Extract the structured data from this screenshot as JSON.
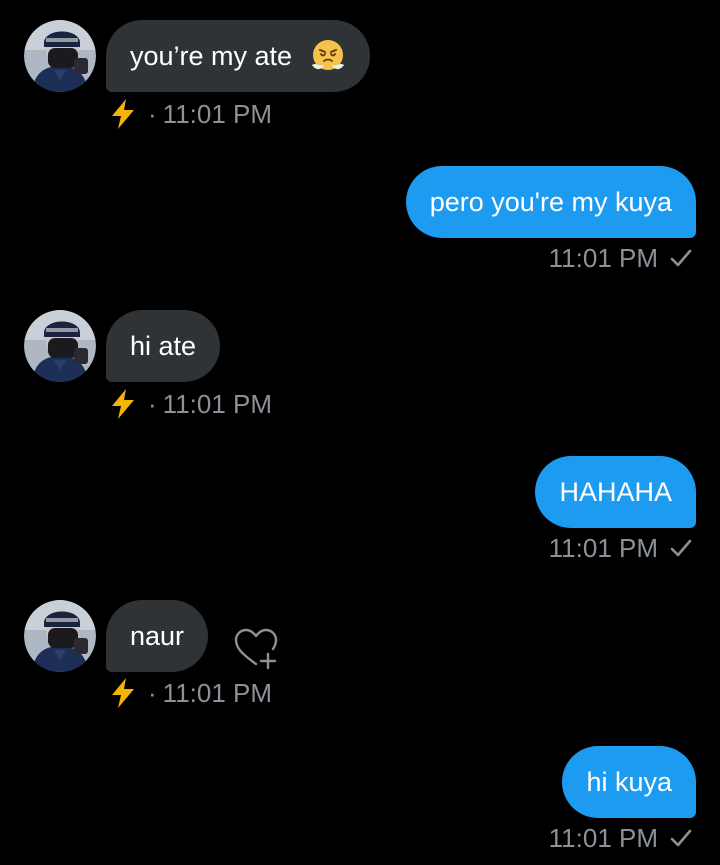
{
  "messages": [
    {
      "direction": "in",
      "text": "you’re my ate",
      "emoji": "steaming-face-emoji",
      "status_icon": "lightning-bolt-icon",
      "separator": "·",
      "time": "11:01 PM"
    },
    {
      "direction": "out",
      "text": "pero you're my kuya",
      "time": "11:01 PM",
      "status_icon": "checkmark-icon"
    },
    {
      "direction": "in",
      "text": "hi ate",
      "status_icon": "lightning-bolt-icon",
      "separator": "·",
      "time": "11:01 PM"
    },
    {
      "direction": "out",
      "text": "HAHAHA",
      "time": "11:01 PM",
      "status_icon": "checkmark-icon"
    },
    {
      "direction": "in",
      "text": "naur",
      "status_icon": "lightning-bolt-icon",
      "separator": "·",
      "time": "11:01 PM",
      "reaction_icon": "heart-plus-icon"
    },
    {
      "direction": "out",
      "text": "hi kuya",
      "time": "11:01 PM",
      "status_icon": "checkmark-icon"
    }
  ],
  "colors": {
    "background": "#000000",
    "incoming_bubble": "#2f3336",
    "outgoing_bubble": "#1d9bf0",
    "meta_text": "#8b9197",
    "lightning": "#f4b400"
  }
}
